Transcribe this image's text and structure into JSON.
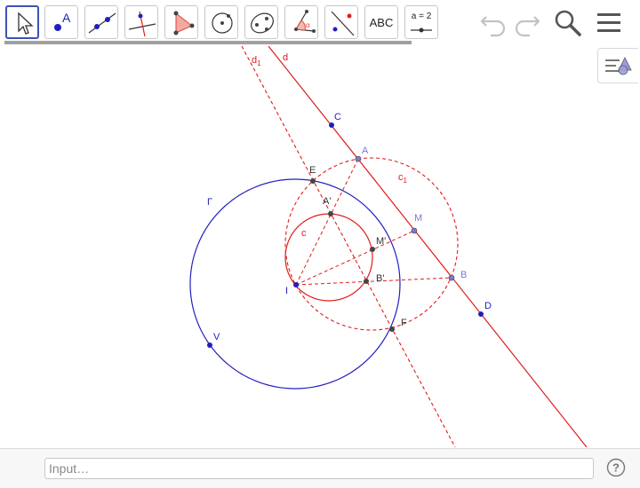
{
  "toolbar": {
    "tools": [
      {
        "name": "move"
      },
      {
        "name": "point"
      },
      {
        "name": "line"
      },
      {
        "name": "perpendicular-line"
      },
      {
        "name": "polygon"
      },
      {
        "name": "circle-center-point"
      },
      {
        "name": "ellipse"
      },
      {
        "name": "angle"
      },
      {
        "name": "reflect-about-line"
      },
      {
        "name": "text",
        "label": "ABC"
      },
      {
        "name": "slider",
        "label": "a = 2"
      }
    ],
    "selected_tool": "move"
  },
  "actions": [
    "undo",
    "redo",
    "search",
    "menu"
  ],
  "input_bar": {
    "placeholder": "Input…",
    "value": ""
  },
  "construction": {
    "colors": {
      "blue": "#1f1fbf",
      "red": "#e11b1b",
      "dark_point": "#444444",
      "light_point": "#7a7ad6"
    },
    "points": {
      "C": "C",
      "A": "A",
      "M": "M",
      "B": "B",
      "D": "D",
      "E": "E",
      "A_prime": "A'",
      "M_prime": "M'",
      "B_prime": "B'",
      "F": "F",
      "I": "I",
      "V": "V"
    },
    "objects": {
      "d": "d",
      "d1": "d",
      "d1_sub": "1",
      "c": "c",
      "c1": "c",
      "c1_sub": "1",
      "gamma": "Γ"
    }
  }
}
